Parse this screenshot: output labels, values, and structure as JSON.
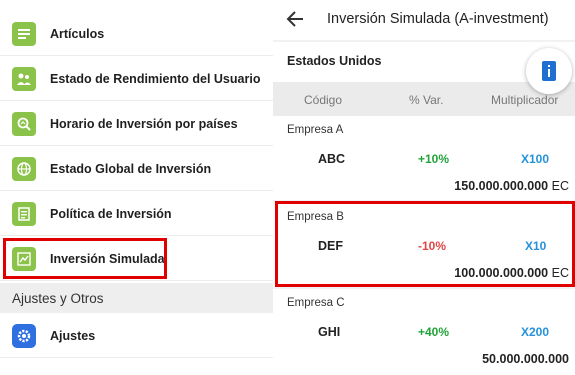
{
  "menu": {
    "items": [
      {
        "label": "Artículos",
        "icon": "articles-icon"
      },
      {
        "label": "Estado de Rendimiento del Usuario",
        "icon": "user-performance-icon"
      },
      {
        "label": "Horario de Inversión por países",
        "icon": "investment-schedule-icon"
      },
      {
        "label": "Estado Global de Inversión",
        "icon": "globe-icon"
      },
      {
        "label": "Política de Inversión",
        "icon": "policy-icon"
      },
      {
        "label": "Inversión Simulada",
        "icon": "chart-icon"
      }
    ],
    "section_header": "Ajustes y Otros",
    "settings_label": "Ajustes"
  },
  "detail": {
    "title": "Inversión Simulada (A-investment)",
    "country": "Estados Unidos",
    "columns": {
      "code": "Código",
      "change": "% Var.",
      "multiplier": "Multiplicador"
    },
    "companies": [
      {
        "name": "Empresa A",
        "code": "ABC",
        "change": "+10%",
        "multiplier": "X100",
        "amount": "150.000.000.000",
        "currency": "EC"
      },
      {
        "name": "Empresa B",
        "code": "DEF",
        "change": "-10%",
        "multiplier": "X10",
        "amount": "100.000.000.000",
        "currency": "EC"
      },
      {
        "name": "Empresa C",
        "code": "GHI",
        "change": "+40%",
        "multiplier": "X200",
        "amount": "50.000.000.000",
        "currency": ""
      }
    ]
  },
  "colors": {
    "highlight": "#e00000",
    "positive": "#22a33a",
    "negative": "#e04646",
    "multiplier": "#2592d8",
    "menu_icon": "#8bc34a",
    "settings_icon": "#2f6fe0"
  }
}
